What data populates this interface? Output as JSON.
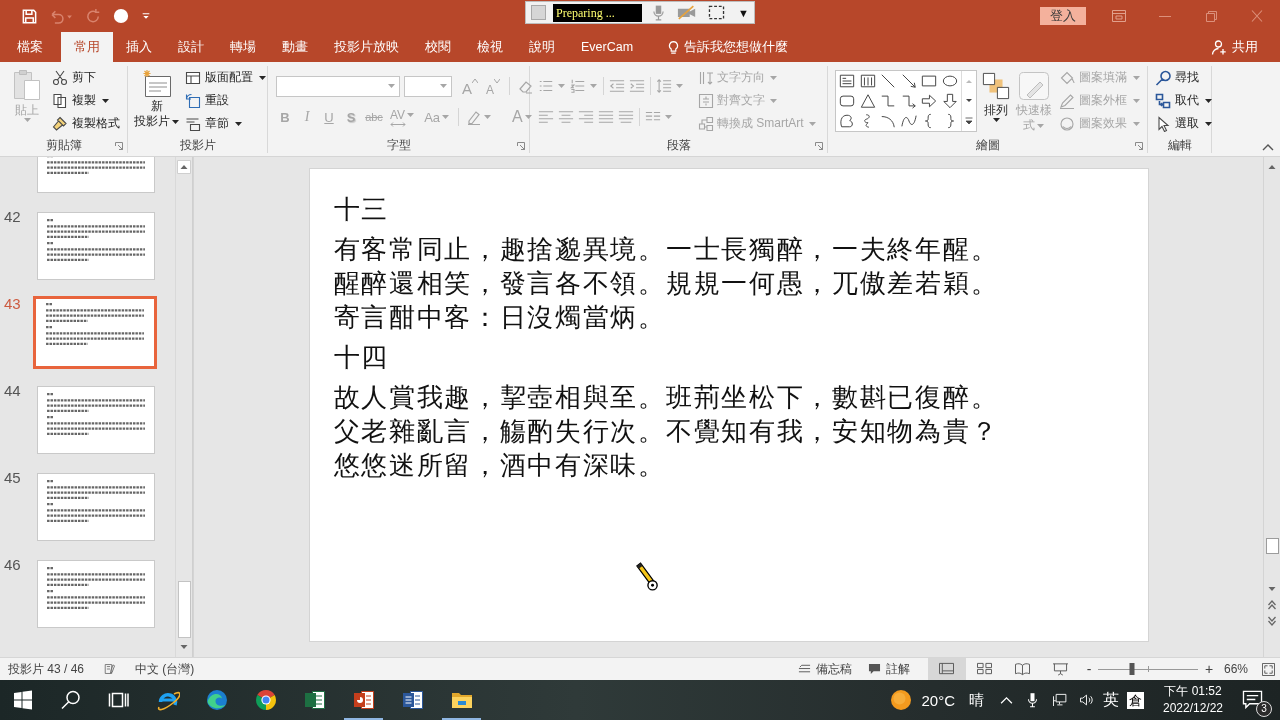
{
  "title_bar": {
    "quick_access": [
      {
        "kind": "save",
        "disabled": false
      },
      {
        "kind": "undo",
        "disabled": true
      },
      {
        "kind": "redo",
        "disabled": true
      },
      {
        "kind": "circle",
        "disabled": false
      },
      {
        "kind": "customize",
        "disabled": false
      }
    ],
    "recorder": {
      "status": "Preparing ...",
      "menu": "▼"
    },
    "sign_in": "登入"
  },
  "tabs": [
    {
      "label": "檔案",
      "selected": false
    },
    {
      "label": "常用",
      "selected": true
    },
    {
      "label": "插入",
      "selected": false
    },
    {
      "label": "設計",
      "selected": false
    },
    {
      "label": "轉場",
      "selected": false
    },
    {
      "label": "動畫",
      "selected": false
    },
    {
      "label": "投影片放映",
      "selected": false
    },
    {
      "label": "校閱",
      "selected": false
    },
    {
      "label": "檢視",
      "selected": false
    },
    {
      "label": "說明",
      "selected": false
    },
    {
      "label": "EverCam",
      "selected": false
    }
  ],
  "tell_me": "告訴我您想做什麼",
  "share": "共用",
  "ribbon": {
    "clipboard": {
      "label": "剪貼簿",
      "paste": {
        "label": "貼上",
        "disabled": true
      },
      "tools": [
        {
          "kind": "cut",
          "label": "剪下",
          "dropdown": false
        },
        {
          "kind": "copy",
          "label": "複製",
          "dropdown": true
        },
        {
          "kind": "painter",
          "label": "複製格式",
          "dropdown": false
        }
      ]
    },
    "slides": {
      "label": "投影片",
      "new_slide": [
        "新",
        "投影片"
      ],
      "tools": [
        {
          "kind": "layout",
          "label": "版面配置",
          "dropdown": true
        },
        {
          "kind": "reset",
          "label": "重設",
          "dropdown": false
        },
        {
          "kind": "section",
          "label": "章節",
          "dropdown": true
        }
      ]
    },
    "font": {
      "label": "字型",
      "disabled": true,
      "grow": "A",
      "shrink": "A",
      "format": [
        {
          "kind": "bold",
          "glyph": "B"
        },
        {
          "kind": "italic",
          "glyph": "I"
        },
        {
          "kind": "underline",
          "glyph": "U"
        },
        {
          "kind": "shadow",
          "glyph": "S"
        },
        {
          "kind": "strike",
          "glyph": "abc"
        },
        {
          "kind": "spacing",
          "glyph": "AV"
        },
        {
          "kind": "case",
          "glyph": "Aa"
        }
      ],
      "color_glyph": "A"
    },
    "paragraph": {
      "label": "段落",
      "disabled": true,
      "tools": [
        {
          "kind": "direction",
          "label": "文字方向",
          "dropdown": true
        },
        {
          "kind": "align",
          "label": "對齊文字",
          "dropdown": true
        },
        {
          "kind": "smartart",
          "label": "轉換成 SmartArt",
          "dropdown": true
        }
      ]
    },
    "drawing": {
      "label": "繪圖",
      "arrange": {
        "label": "排列",
        "disabled": false
      },
      "quick_styles": {
        "label": "快速樣式",
        "disabled": true
      },
      "tools": [
        {
          "kind": "fill",
          "label": "圖案填滿",
          "disabled": true
        },
        {
          "kind": "outline",
          "label": "圖案外框",
          "disabled": true
        },
        {
          "kind": "effects",
          "label": "圖案效果",
          "disabled": true
        }
      ]
    },
    "editing": {
      "label": "編輯",
      "tools": [
        {
          "kind": "find",
          "label": "尋找",
          "dropdown": false
        },
        {
          "kind": "replace",
          "label": "取代",
          "dropdown": true
        },
        {
          "kind": "select",
          "label": "選取",
          "dropdown": true
        }
      ]
    }
  },
  "slides_pane": {
    "thumbnails": [
      {
        "selected": false
      },
      {
        "number": "42",
        "selected": false
      },
      {
        "number": "43",
        "selected": true
      },
      {
        "number": "44",
        "selected": false
      },
      {
        "number": "45",
        "selected": false
      },
      {
        "number": "46",
        "selected": false
      }
    ]
  },
  "slide": {
    "lines": [
      {
        "kind": "heading",
        "text": "十三"
      },
      {
        "kind": "verse",
        "text": "有客常同止，趣捨邈異境。一士長獨醉，一夫終年醒。"
      },
      {
        "kind": "verse",
        "text": "醒醉還相笑，發言各不領。規規一何愚，兀傲差若穎。"
      },
      {
        "kind": "verse",
        "text": "寄言酣中客：日沒燭當炳。"
      },
      {
        "kind": "heading",
        "text": "十四"
      },
      {
        "kind": "verse",
        "text": "故人賞我趣，挈壺相與至。班荊坐松下，數斟已復醉。"
      },
      {
        "kind": "verse",
        "text": "父老雜亂言，觴酌失行次。不覺知有我，安知物為貴？"
      },
      {
        "kind": "verse",
        "text": "悠悠迷所留，酒中有深味。"
      }
    ]
  },
  "status_bar": {
    "slide_counter": "投影片 43 / 46",
    "language": "中文 (台灣)",
    "notes": "備忘稿",
    "comments": "註解",
    "views": [
      {
        "kind": "normal",
        "selected": true
      },
      {
        "kind": "sorter",
        "selected": false
      },
      {
        "kind": "reading",
        "selected": false
      },
      {
        "kind": "slideshow",
        "selected": false
      }
    ],
    "zoom_out": "-",
    "zoom_in": "+",
    "zoom": {
      "level": 0.34
    },
    "zoom_percent": "66%"
  },
  "taskbar": {
    "apps": [
      {
        "kind": "ie",
        "running": false
      },
      {
        "kind": "edge",
        "running": false
      },
      {
        "kind": "chrome",
        "running": false
      },
      {
        "kind": "excel",
        "running": false
      },
      {
        "kind": "powerpoint",
        "running": true
      },
      {
        "kind": "word",
        "running": false
      },
      {
        "kind": "explorer",
        "running": true
      }
    ],
    "weather": {
      "temperature": "20°C",
      "condition": "晴"
    },
    "input_language": "英",
    "ime": "倉",
    "time": "下午 01:52",
    "date": "2022/12/22",
    "notifications": "3"
  }
}
